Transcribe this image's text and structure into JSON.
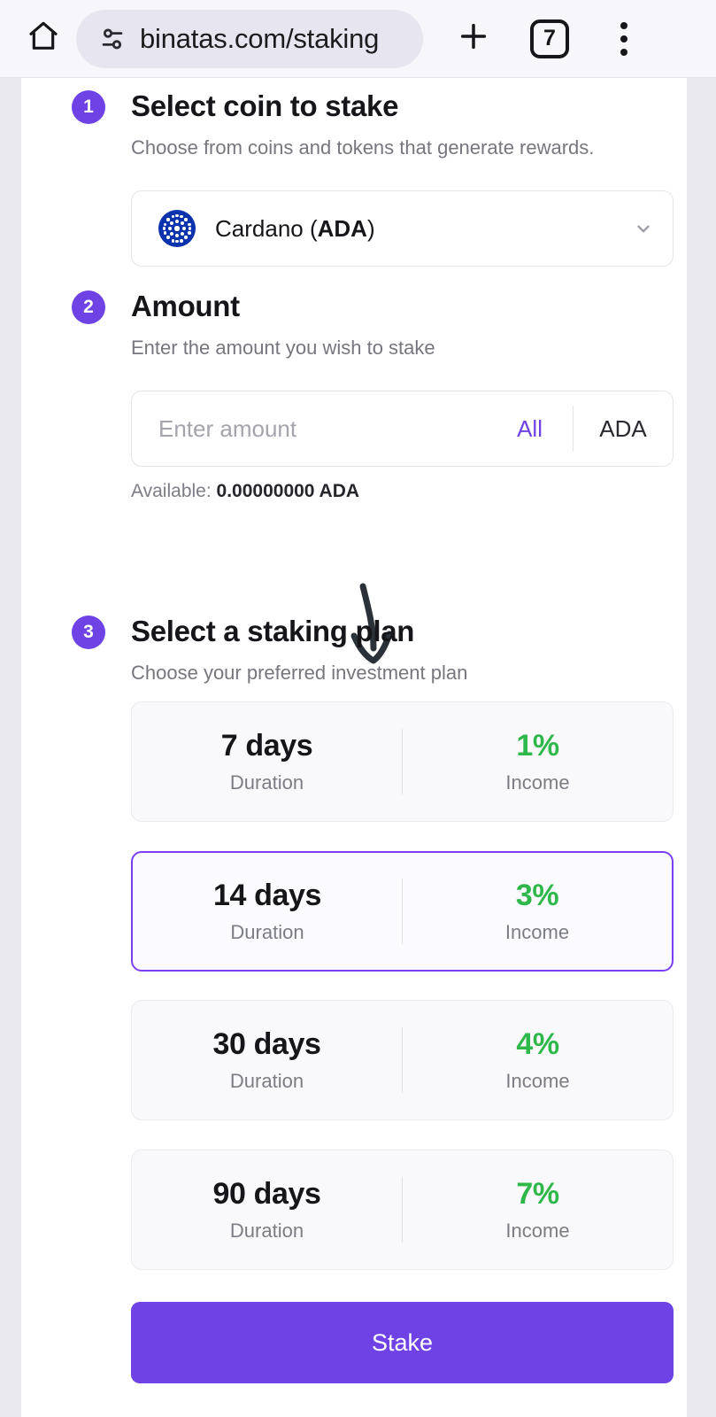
{
  "browser": {
    "home_icon": "home-icon",
    "site_info_icon": "tune-icon",
    "url": "binatas.com/staking",
    "new_tab_icon": "plus-icon",
    "tab_count": "7",
    "menu_icon": "more-vertical-icon"
  },
  "steps": [
    {
      "number": "1",
      "title": "Select coin to stake",
      "subtitle": "Choose from coins and tokens that generate rewards.",
      "coin": {
        "name": "Cardano (",
        "symbol": "ADA",
        "name_end": ")",
        "logo_icon": "cardano-logo-icon",
        "chevron_icon": "chevron-down-icon"
      }
    },
    {
      "number": "2",
      "title": "Amount",
      "subtitle": "Enter the amount you wish to stake",
      "input": {
        "value": "",
        "placeholder": "Enter amount"
      },
      "all_label": "All",
      "unit": "ADA",
      "available_label": "Available:",
      "available_value": "0.00000000 ADA"
    },
    {
      "number": "3",
      "title": "Select a staking plan",
      "subtitle": "Choose your preferred investment plan"
    }
  ],
  "plans": [
    {
      "duration": "7 days",
      "duration_label": "Duration",
      "income": "1%",
      "income_label": "Income",
      "selected": false
    },
    {
      "duration": "14 days",
      "duration_label": "Duration",
      "income": "3%",
      "income_label": "Income",
      "selected": true
    },
    {
      "duration": "30 days",
      "duration_label": "Duration",
      "income": "4%",
      "income_label": "Income",
      "selected": false
    },
    {
      "duration": "90 days",
      "duration_label": "Duration",
      "income": "7%",
      "income_label": "Income",
      "selected": false
    }
  ],
  "submit": {
    "label": "Stake"
  },
  "annotation": {
    "icon": "curved-down-arrow-icon"
  },
  "colors": {
    "accent_purple": "#6e42e5",
    "selected_border": "#7b3ff2",
    "income_green": "#2eb84a",
    "cardano_blue": "#0a33ad",
    "page_bg": "#e9e9ee"
  }
}
